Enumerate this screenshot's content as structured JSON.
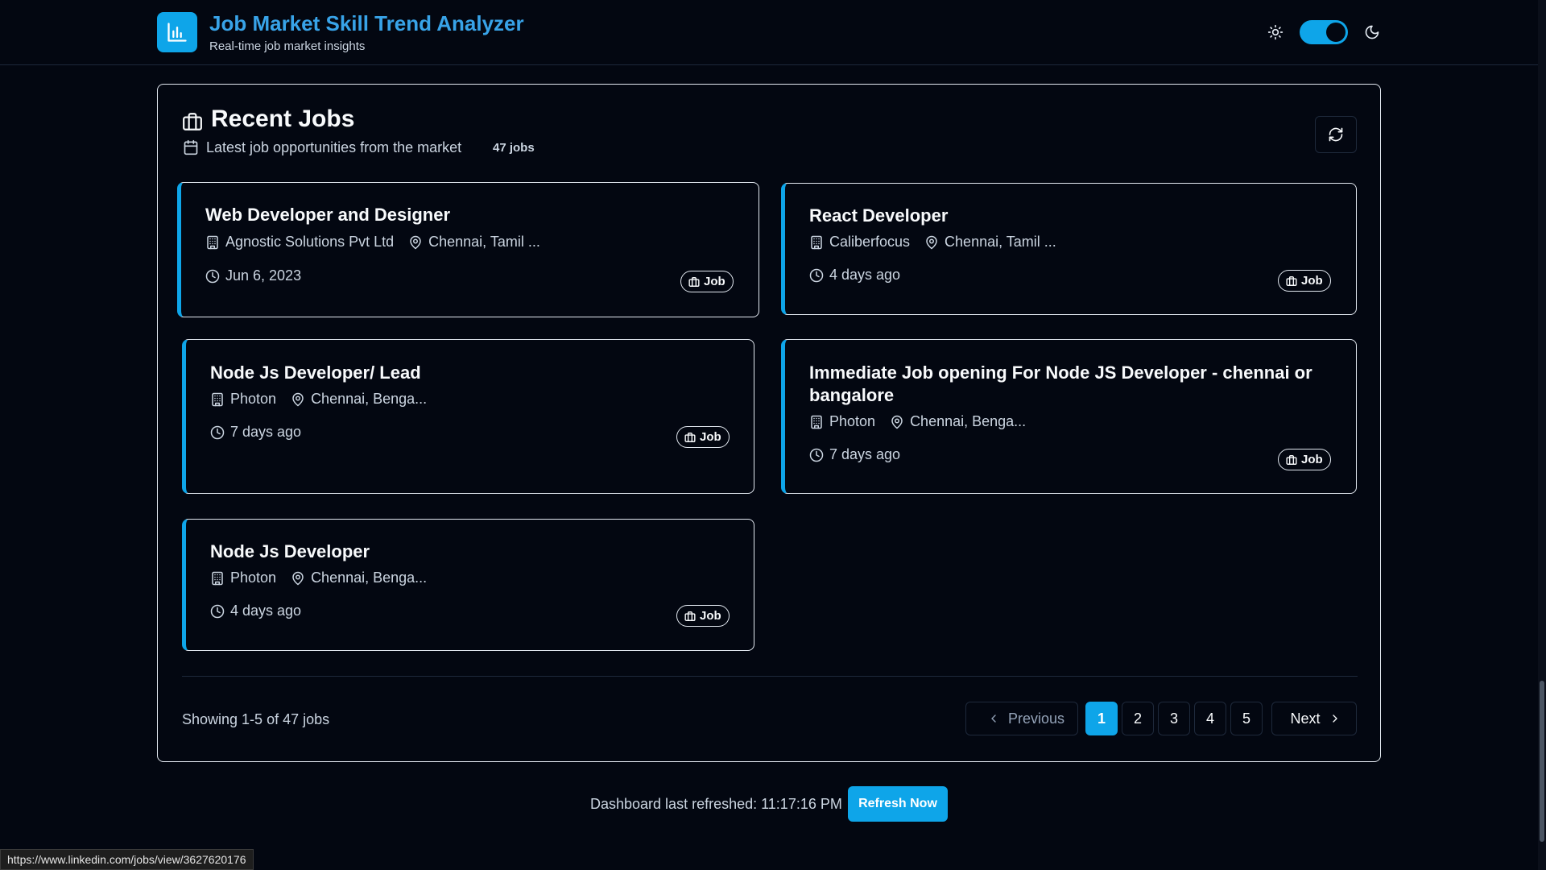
{
  "header": {
    "title": "Job Market Skill Trend Analyzer",
    "subtitle": "Real-time job market insights",
    "logo_icon": "bar-chart-icon",
    "theme": {
      "light_icon": "sun-icon",
      "dark_icon": "moon-icon",
      "dark_mode_on": true
    }
  },
  "panel": {
    "title": "Recent Jobs",
    "subtitle": "Latest job opportunities from the market",
    "count_label": "47 jobs",
    "refresh_icon": "refresh-icon"
  },
  "jobs": [
    {
      "title": "Web Developer and Designer",
      "company": "Agnostic Solutions Pvt Ltd",
      "location": "Chennai, Tamil ...",
      "posted": "Jun 6, 2023",
      "badge": "Job"
    },
    {
      "title": "React Developer",
      "company": "Caliberfocus",
      "location": "Chennai, Tamil ...",
      "posted": "4 days ago",
      "badge": "Job"
    },
    {
      "title": "Node Js Developer/ Lead",
      "company": "Photon",
      "location": "Chennai, Benga...",
      "posted": "7 days ago",
      "badge": "Job"
    },
    {
      "title": "Immediate Job opening For Node JS Developer - chennai or bangalore",
      "company": "Photon",
      "location": "Chennai, Benga...",
      "posted": "7 days ago",
      "badge": "Job"
    },
    {
      "title": "Node Js Developer",
      "company": "Photon",
      "location": "Chennai, Benga...",
      "posted": "4 days ago",
      "badge": "Job"
    }
  ],
  "pagination": {
    "showing": "Showing 1-5 of 47 jobs",
    "previous": "Previous",
    "next": "Next",
    "pages": [
      "1",
      "2",
      "3",
      "4",
      "5"
    ],
    "current": "1"
  },
  "footer": {
    "refreshed": "Dashboard last refreshed: 11:17:16 PM",
    "refresh_button": "Refresh Now"
  },
  "status_bar": {
    "url": "https://www.linkedin.com/jobs/view/3627620176"
  },
  "colors": {
    "accent": "#0ea5e9",
    "background": "#030711",
    "title": "#38a3e8",
    "border": "#e2e8f0"
  }
}
